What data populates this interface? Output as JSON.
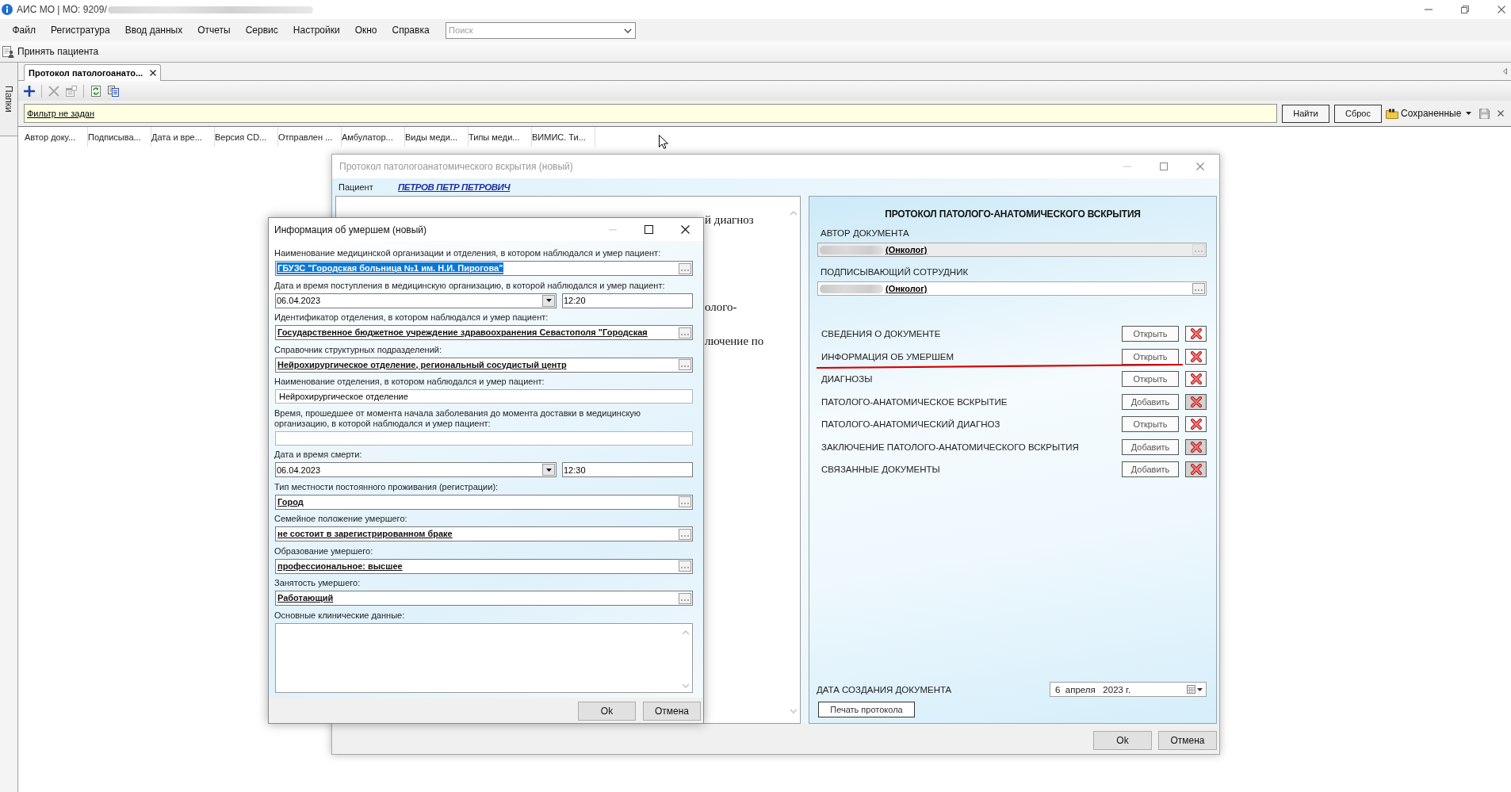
{
  "window": {
    "title": "АИС МО | МО: 9209/"
  },
  "menu": [
    "Файл",
    "Регистратура",
    "Ввод данных",
    "Отчеты",
    "Сервис",
    "Настройки",
    "Окно",
    "Справка"
  ],
  "search": {
    "placeholder": "Поиск"
  },
  "toolbar": {
    "button": "Принять пациента"
  },
  "sidebar": {
    "tab": "Папки"
  },
  "tabs": [
    {
      "label": "Протокол патологоанато...",
      "selected": true
    }
  ],
  "list_toolbar": {
    "groups": [
      [
        {
          "kind": "add",
          "disabled": false
        }
      ],
      [
        {
          "kind": "delete",
          "disabled": true
        },
        {
          "kind": "properties",
          "disabled": true
        }
      ],
      [
        {
          "kind": "refresh",
          "disabled": false
        },
        {
          "kind": "copy",
          "disabled": false
        }
      ]
    ]
  },
  "filter": {
    "link": "Фильтр не задан",
    "buttons": [
      "Найти",
      "Сброс"
    ],
    "saved": "Сохраненные"
  },
  "table": {
    "columns": [
      "Автор доку...",
      "Подписыва...",
      "Дата и вре...",
      "Версия CD...",
      "Отправлен ...",
      "Амбулатор...",
      "Виды меди...",
      "Типы меди...",
      "ВИМИС. Ти..."
    ]
  },
  "protocol_window": {
    "title": "Протокол патологоанатомического вскрытия (новый)",
    "active": false,
    "patient_label": "Пациент",
    "patient": "ПЕТРОВ ПЕТР ПЕТРОВИЧ",
    "document_fragments": [
      "й диагноз",
      "олого-",
      "лючение по"
    ],
    "panel": {
      "title": "ПРОТОКОЛ ПАТОЛОГО-АНАТОМИЧЕСКОГО ВСКРЫТИЯ",
      "fields": [
        {
          "label": "АВТОР ДОКУМЕНТА",
          "value": "(Онколог)",
          "disabled": true
        },
        {
          "label": "ПОДПИСЫВАЮЩИЙ СОТРУДНИК",
          "value": "(Онколог)",
          "disabled": false
        }
      ],
      "sections": [
        {
          "label": "СВЕДЕНИЯ О ДОКУМЕНТЕ",
          "action": "Открыть",
          "delete_disabled": false,
          "marked": false
        },
        {
          "label": "ИНФОРМАЦИЯ ОБ УМЕРШЕМ",
          "action": "Открыть",
          "delete_disabled": false,
          "marked": true
        },
        {
          "label": "ДИАГНОЗЫ",
          "action": "Открыть",
          "delete_disabled": false,
          "marked": false
        },
        {
          "label": "ПАТОЛОГО-АНАТОМИЧЕСКОЕ ВСКРЫТИЕ",
          "action": "Добавить",
          "delete_disabled": true,
          "marked": false
        },
        {
          "label": "ПАТОЛОГО-АНАТОМИЧЕСКИЙ ДИАГНОЗ",
          "action": "Открыть",
          "delete_disabled": false,
          "marked": false
        },
        {
          "label": "ЗАКЛЮЧЕНИЕ ПАТОЛОГО-АНАТОМИЧЕСКОГО ВСКРЫТИЯ",
          "action": "Добавить",
          "delete_disabled": true,
          "marked": false
        },
        {
          "label": "СВЯЗАННЫЕ ДОКУМЕНТЫ",
          "action": "Добавить",
          "delete_disabled": true,
          "marked": false
        }
      ],
      "date_label": "ДАТА СОЗДАНИЯ ДОКУМЕНТА",
      "date": "6  апреля   2023 г.",
      "print_button": "Печать протокола"
    },
    "buttons": [
      "Ok",
      "Отмена"
    ]
  },
  "info_dialog": {
    "title": "Информация об умершем (новый)",
    "active": true,
    "fields": [
      {
        "kind": "lookup",
        "label": "Наименование медицинской организации и отделения, в котором наблюдался и умер пациент:",
        "value": "ГБУЗС \"Городская больница №1 им. Н.И. Пирогова\"",
        "selected": true
      },
      {
        "kind": "datetime",
        "label": "Дата и время поступления в медицинскую организацию, в которой наблюдался и умер пациент:",
        "date": "06.04.2023",
        "time": "12:20"
      },
      {
        "kind": "lookup",
        "label": "Идентификатор отделения, в котором наблюдался и умер пациент:",
        "value": "Государственное бюджетное учреждение здравоохранения Севастополя \"Городская",
        "selected": false
      },
      {
        "kind": "lookup",
        "label": "Справочник структурных подразделений:",
        "value": "Нейрохирургическое отделение, региональный сосудистый центр",
        "selected": false
      },
      {
        "kind": "text",
        "label": "Наименование отделения, в котором наблюдался и умер пациент:",
        "value": "Нейрохирургическое отделение"
      },
      {
        "kind": "text",
        "label": "Время, прошедшее от момента начала заболевания до момента доставки в медицинскую организацию, в которой наблюдался и умер пациент:"
      },
      {
        "kind": "datetime",
        "label": "Дата и время смерти:",
        "date": "06.04.2023",
        "time": "12:30"
      },
      {
        "kind": "lookup",
        "label": "Тип местности постоянного проживания (регистрации):",
        "value": "Город",
        "selected": false
      },
      {
        "kind": "lookup",
        "label": "Семейное положение умершего:",
        "value": "не состоит в зарегистрированном браке",
        "selected": false
      },
      {
        "kind": "lookup",
        "label": "Образование умершего:",
        "value": "профессиональное: высшее",
        "selected": false
      },
      {
        "kind": "lookup",
        "label": "Занятость умершего:",
        "value": "Работающий",
        "selected": false
      },
      {
        "kind": "memo",
        "label": "Основные клинические данные:"
      }
    ],
    "buttons": [
      "Ok",
      "Отмена"
    ]
  }
}
